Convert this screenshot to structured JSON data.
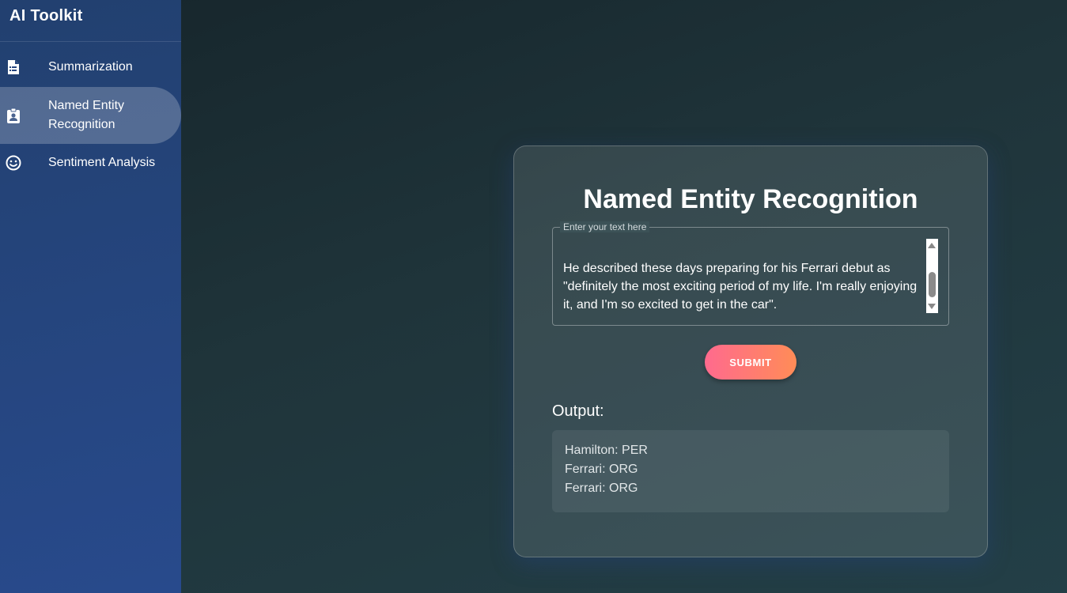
{
  "sidebar": {
    "brand": "AI Toolkit",
    "items": [
      {
        "label": "Summarization",
        "icon": "document-icon",
        "active": false
      },
      {
        "label": "Named Entity\nRecognition",
        "icon": "contact-badge-icon",
        "active": true
      },
      {
        "label": "Sentiment Analysis",
        "icon": "smiley-icon",
        "active": false
      }
    ]
  },
  "main": {
    "title": "Named Entity Recognition",
    "input": {
      "legend": "Enter your text here",
      "value": "He described these days preparing for his Ferrari debut as \"definitely the most exciting period of my life. I'm really enjoying it, and I'm so excited to get in the car\"."
    },
    "submit_label": "SUBMIT",
    "output_label": "Output:",
    "output_lines": [
      "Hamilton: PER",
      "Ferrari: ORG",
      "Ferrari: ORG"
    ]
  },
  "colors": {
    "sidebar_bg": "#284a8c",
    "page_bg": "#1f343a",
    "submit_gradient_start": "#ff6a8e",
    "submit_gradient_end": "#ff8c57"
  }
}
